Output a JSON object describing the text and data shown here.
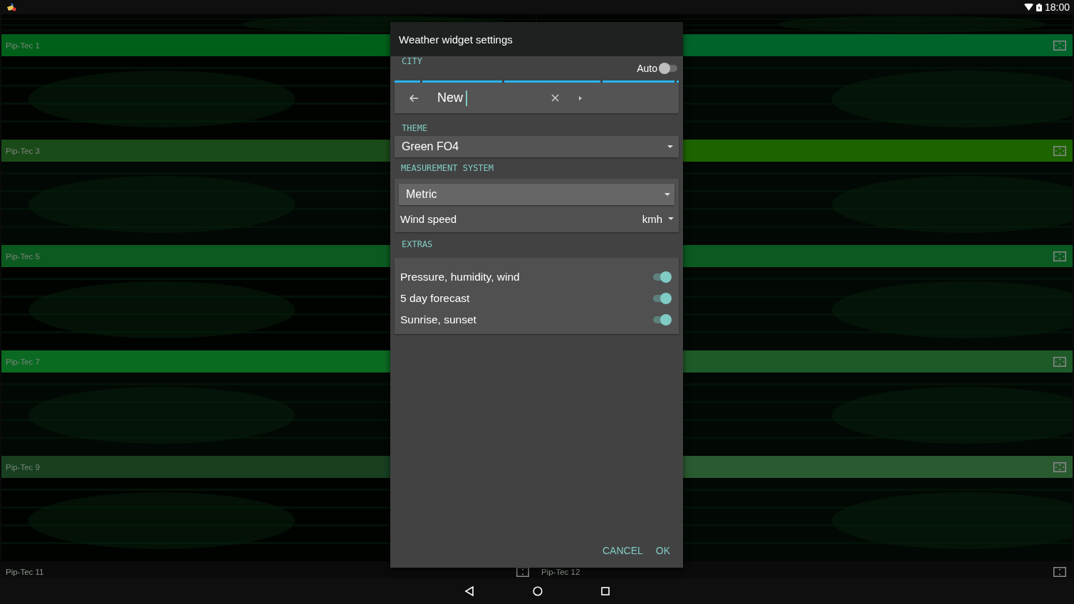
{
  "status_bar": {
    "time": "18:00"
  },
  "tiles": [
    {
      "label": "Pip-Tec 1",
      "color": "#00601a"
    },
    {
      "color": "#00632a"
    },
    {
      "label": "Pip-Tec 3",
      "color": "#1b4a19"
    },
    {
      "color": "#1d6400"
    },
    {
      "label": "Pip-Tec 5",
      "color": "#0b5a1f"
    },
    {
      "color": "#0a5a22"
    },
    {
      "label": "Pip-Tec 7",
      "color": "#0b6a22"
    },
    {
      "color": "#1e5a28"
    },
    {
      "label": "Pip-Tec 9",
      "color": "#173f20"
    },
    {
      "color": "#2a5a30"
    },
    {
      "label": "Pip-Tec 11",
      "color": "#0a0b0a"
    },
    {
      "label": "Pip-Tec 12",
      "color": "#0a0b0a"
    }
  ],
  "dialog": {
    "title": "Weather widget settings",
    "city": {
      "label": "CITY",
      "auto": {
        "label": "Auto",
        "on": false
      },
      "search": {
        "value": "New"
      }
    },
    "theme": {
      "label": "THEME",
      "value": "Green FO4"
    },
    "measurement": {
      "label": "MEASUREMENT SYSTEM",
      "system": "Metric",
      "wind": {
        "label": "Wind speed",
        "value": "kmh"
      }
    },
    "extras": {
      "label": "EXTRAS",
      "items": [
        {
          "label": "Pressure, humidity, wind",
          "on": true
        },
        {
          "label": "5 day forecast",
          "on": true
        },
        {
          "label": "Sunrise, sunset",
          "on": true
        }
      ]
    },
    "buttons": [
      {
        "label": "CANCEL"
      },
      {
        "label": "OK"
      }
    ]
  }
}
